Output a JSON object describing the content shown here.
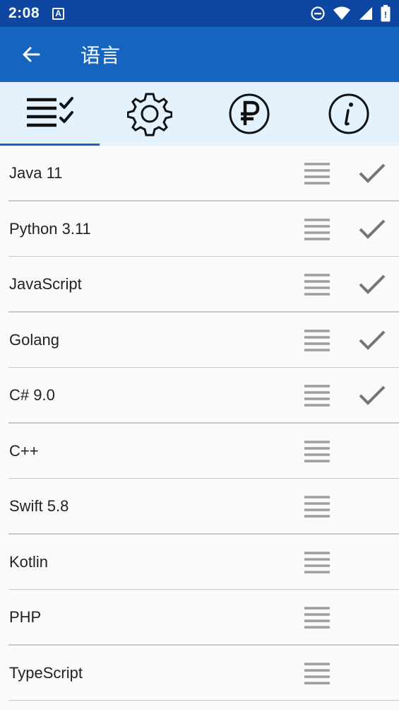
{
  "status": {
    "time": "2:08",
    "a_label": "A"
  },
  "appbar": {
    "title": "语言"
  },
  "tabs": [
    {
      "name": "languages",
      "icon": "checklist-icon",
      "active": true
    },
    {
      "name": "settings",
      "icon": "gear-icon",
      "active": false
    },
    {
      "name": "donate",
      "icon": "ruble-icon",
      "active": false
    },
    {
      "name": "about",
      "icon": "info-icon",
      "active": false
    }
  ],
  "languages": [
    {
      "label": "Java 11",
      "checked": true
    },
    {
      "label": "Python 3.11",
      "checked": true
    },
    {
      "label": "JavaScript",
      "checked": true
    },
    {
      "label": "Golang",
      "checked": true
    },
    {
      "label": "C# 9.0",
      "checked": true
    },
    {
      "label": "C++",
      "checked": false
    },
    {
      "label": "Swift 5.8",
      "checked": false
    },
    {
      "label": "Kotlin",
      "checked": false
    },
    {
      "label": "PHP",
      "checked": false
    },
    {
      "label": "TypeScript",
      "checked": false
    }
  ],
  "colors": {
    "status_bar": "#0d47a1",
    "app_bar": "#1565c0",
    "tab_bar": "#e3f2fd",
    "accent": "#1565c0"
  }
}
